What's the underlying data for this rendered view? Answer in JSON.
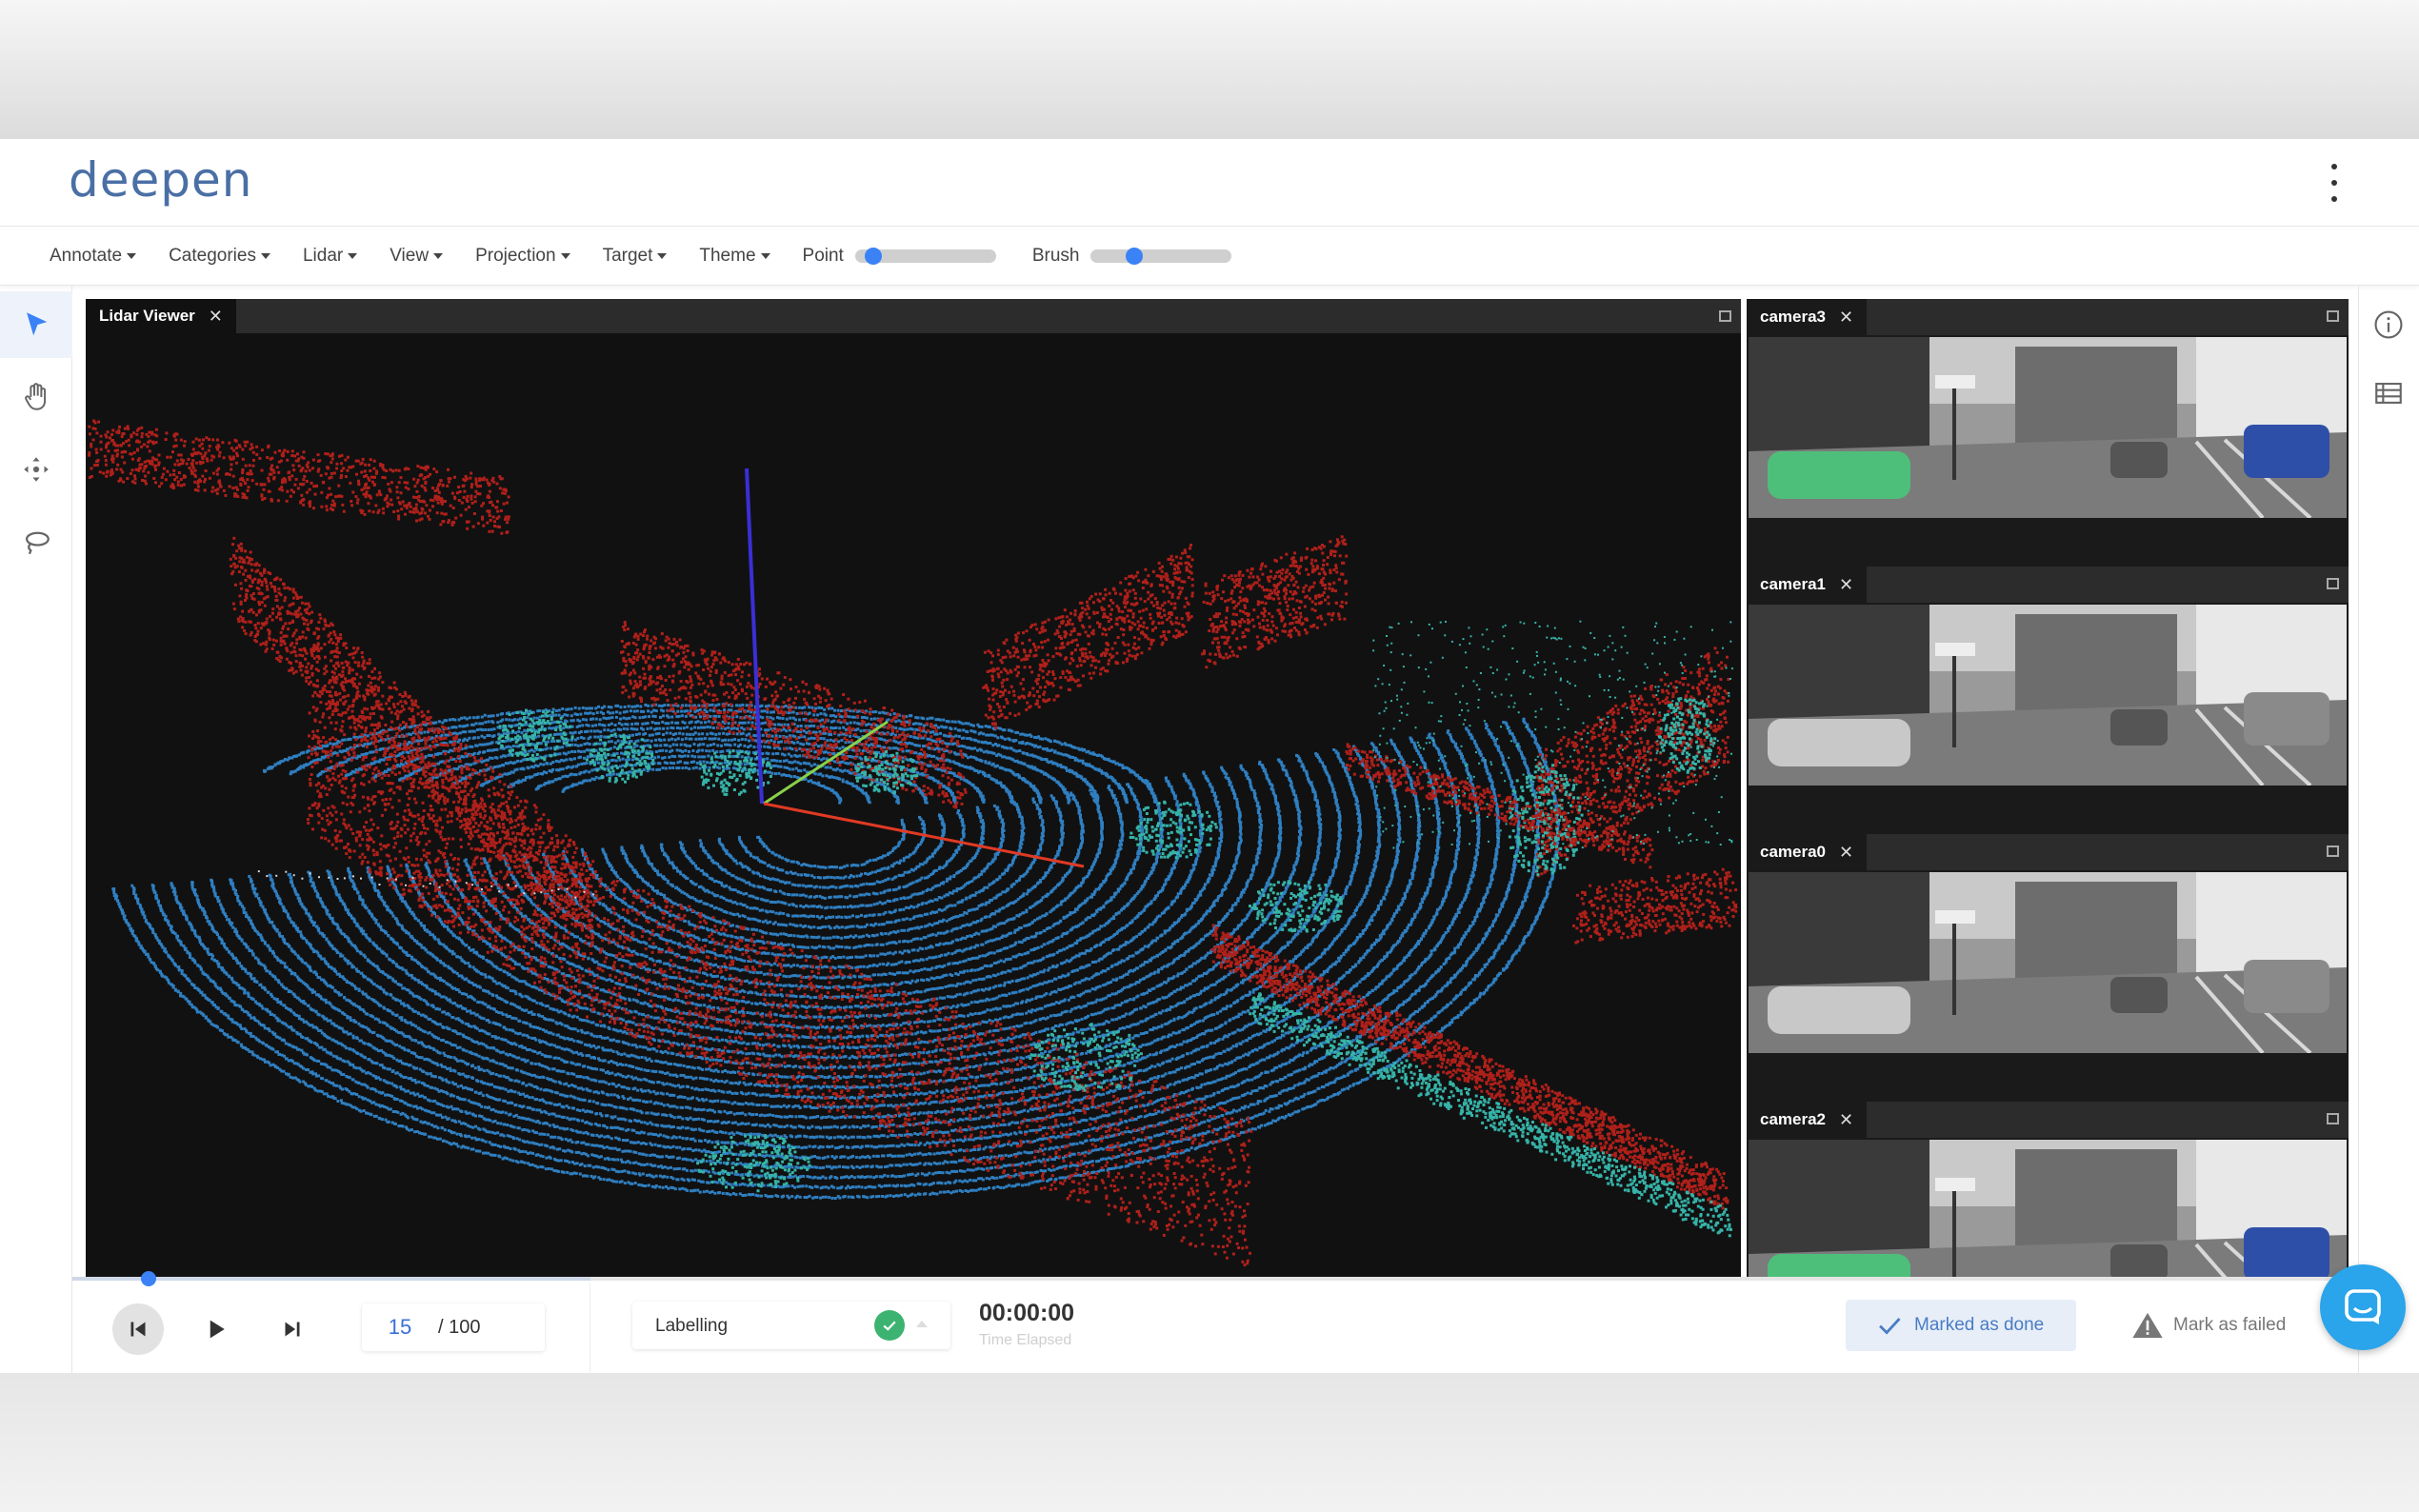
{
  "header": {
    "logo": "deepen"
  },
  "menubar": {
    "menus": [
      "Annotate",
      "Categories",
      "Lidar",
      "View",
      "Projection",
      "Target",
      "Theme"
    ],
    "point_label": "Point",
    "point_value": 0.08,
    "brush_label": "Brush",
    "brush_value": 0.28
  },
  "tools": {
    "items": [
      "select-arrow-icon",
      "hand-pan-icon",
      "move-icon",
      "lasso-icon"
    ],
    "active": "select-arrow-icon"
  },
  "rightrail": {
    "icons": [
      "info-icon",
      "list-icon"
    ]
  },
  "lidar": {
    "tab_label": "Lidar Viewer"
  },
  "cameras": [
    {
      "label": "camera3"
    },
    {
      "label": "camera1"
    },
    {
      "label": "camera0"
    },
    {
      "label": "camera2"
    }
  ],
  "playback": {
    "current_frame": "15",
    "total_frames": "/ 100"
  },
  "stage": {
    "label": "Labelling"
  },
  "timer": {
    "value": "00:00:00",
    "caption": "Time Elapsed"
  },
  "actions": {
    "done_label": "Marked as done",
    "fail_label": "Mark as failed"
  },
  "colors": {
    "accent": "#3b82f6",
    "ground": "#2f7fc1",
    "objects": "#36b3a8",
    "walls": "#b0201a",
    "check": "#3cb371",
    "chat": "#2aa4ea"
  }
}
